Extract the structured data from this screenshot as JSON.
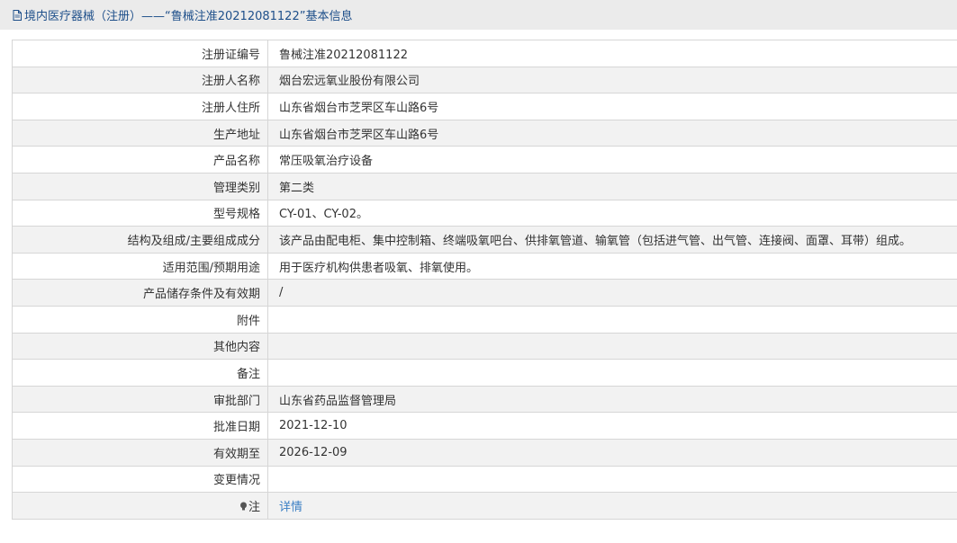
{
  "header": {
    "title": "境内医疗器械（注册）——“鲁械注准20212081122”基本信息",
    "icon": "document-icon"
  },
  "rows": [
    {
      "label": "注册证编号",
      "value": "鲁械注准20212081122"
    },
    {
      "label": "注册人名称",
      "value": "烟台宏远氧业股份有限公司"
    },
    {
      "label": "注册人住所",
      "value": "山东省烟台市芝罘区车山路6号"
    },
    {
      "label": "生产地址",
      "value": "山东省烟台市芝罘区车山路6号"
    },
    {
      "label": "产品名称",
      "value": "常压吸氧治疗设备"
    },
    {
      "label": "管理类别",
      "value": "第二类"
    },
    {
      "label": "型号规格",
      "value": "CY-01、CY-02。"
    },
    {
      "label": "结构及组成/主要组成成分",
      "value": "该产品由配电柜、集中控制箱、终端吸氧吧台、供排氧管道、输氧管（包括进气管、出气管、连接阀、面罩、耳带）组成。"
    },
    {
      "label": "适用范围/预期用途",
      "value": "用于医疗机构供患者吸氧、排氧使用。"
    },
    {
      "label": "产品储存条件及有效期",
      "value": "/"
    },
    {
      "label": "附件",
      "value": ""
    },
    {
      "label": "其他内容",
      "value": ""
    },
    {
      "label": "备注",
      "value": ""
    },
    {
      "label": "审批部门",
      "value": "山东省药品监督管理局"
    },
    {
      "label": "批准日期",
      "value": "2021-12-10"
    },
    {
      "label": "有效期至",
      "value": "2026-12-09"
    },
    {
      "label": "变更情况",
      "value": ""
    }
  ],
  "note_row": {
    "icon": "lightbulb-icon",
    "label": "注",
    "link_text": "详情"
  },
  "colors": {
    "title_text": "#1e4f8a",
    "link": "#3b7fc4",
    "row_alt": "#f2f2f2",
    "border": "#d6d6d6"
  }
}
